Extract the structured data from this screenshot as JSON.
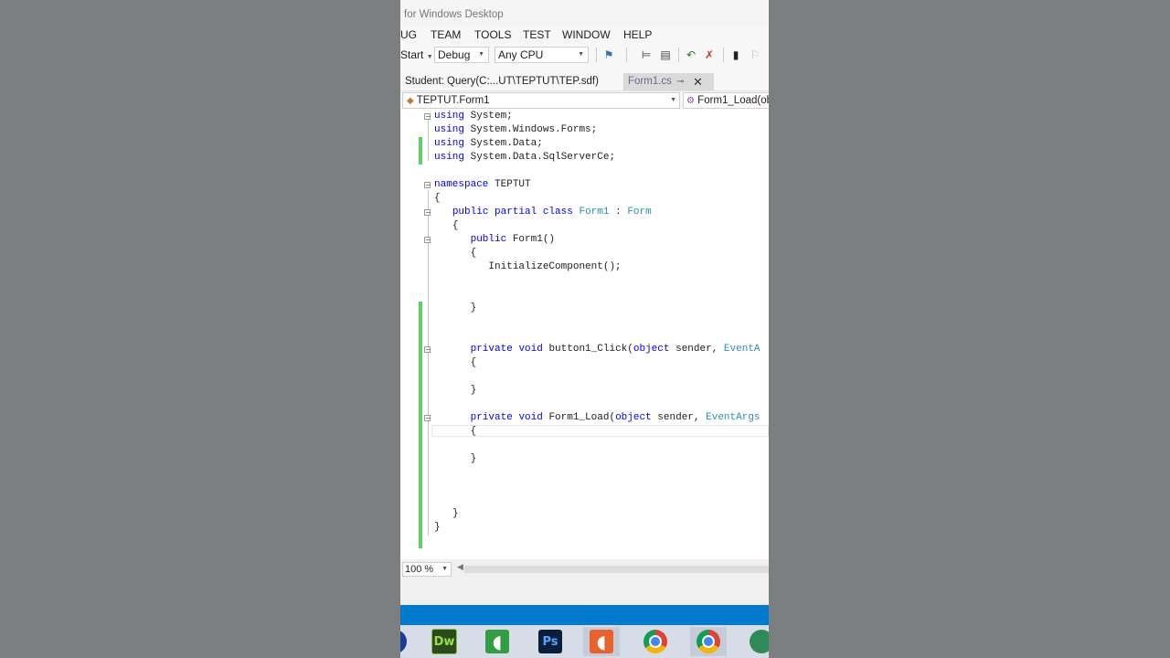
{
  "window": {
    "title": "for Windows Desktop"
  },
  "menu": {
    "items": [
      "UG",
      "TEAM",
      "TOOLS",
      "TEST",
      "WINDOW",
      "HELP"
    ]
  },
  "toolbar": {
    "start_label": "Start",
    "config_value": "Debug",
    "platform_value": "Any CPU"
  },
  "tabs": [
    {
      "label": "Student: Query(C:...UT\\TEPTUT\\TEP.sdf)"
    },
    {
      "label": "Form1.cs"
    }
  ],
  "navbar": {
    "type_value": "TEPTUT.Form1",
    "member_value": "Form1_Load(ob"
  },
  "code": {
    "l1": "System;",
    "l2": "System.Windows.Forms;",
    "l3": "System.Data;",
    "l4": "System.Data.SqlServerCe;",
    "ns_name": "TEPTUT",
    "class_name": "Form1",
    "base_class": "Form",
    "ctor_name": "Form1()",
    "init_call": "InitializeComponent();",
    "m1_name": "button1_Click(",
    "m1_arg_type": "EventA",
    "m2_name": "Form1_Load(",
    "m2_arg_type": "EventArgs",
    "sender": "sender,",
    "kw_using": "using",
    "kw_namespace": "namespace",
    "kw_public": "public",
    "kw_partial": "partial",
    "kw_class": "class",
    "kw_private": "private",
    "kw_void": "void",
    "kw_object": "object",
    "colon": ":",
    "open_brace": "{",
    "close_brace": "}"
  },
  "status": {
    "zoom_value": "100 %"
  },
  "taskbar": {
    "dw_label": "Dw",
    "ps_label": "Ps"
  },
  "colors": {
    "keyword": "#0000ff",
    "type": "#2b91af",
    "change_bar": "#5fcf68",
    "status_bar": "#007acc"
  }
}
